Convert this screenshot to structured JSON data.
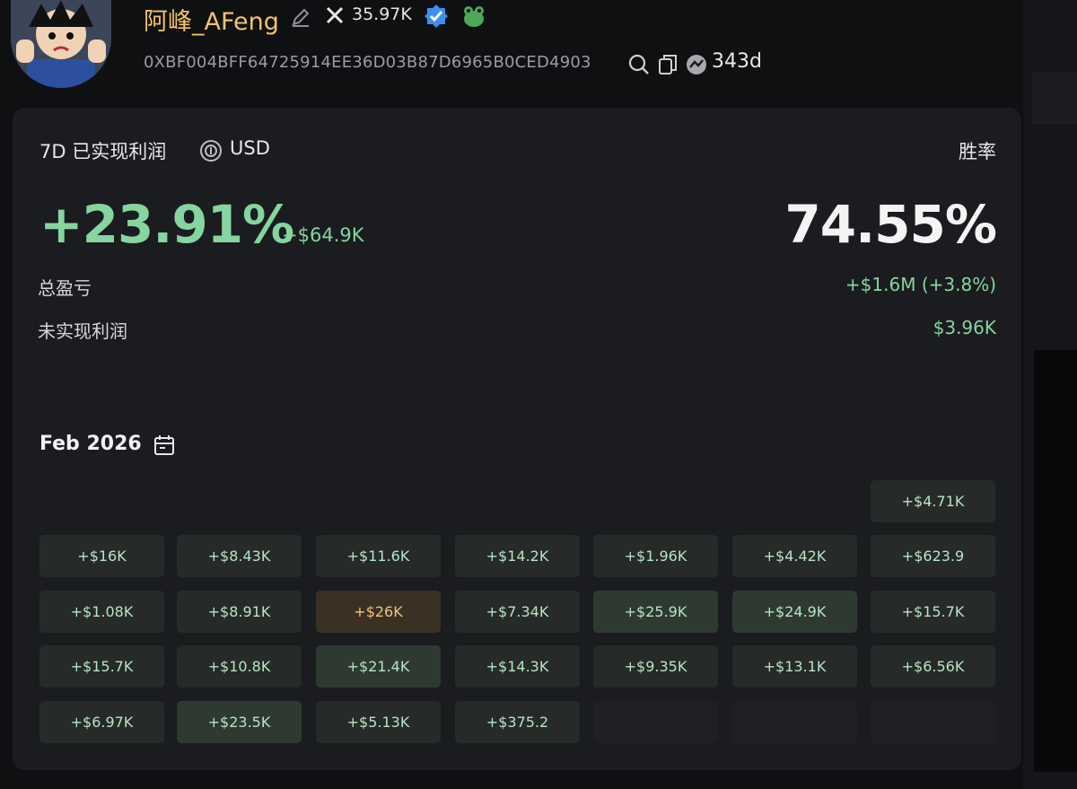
{
  "header": {
    "name": "阿峰_AFeng",
    "followers": "35.97K",
    "address": "0XBF004BFF64725914EE36D03B87D6965B0CED4903",
    "age": "343d",
    "icons": [
      "avatar",
      "edit-icon",
      "x-icon",
      "verified-icon",
      "frog-icon",
      "search-icon",
      "copy-icon",
      "age-icon"
    ]
  },
  "stats": {
    "period_label": "7D 已实现利润",
    "currency": "USD",
    "winrate_label": "胜率",
    "pnl_pct": "+23.91%",
    "pnl_abs": "+$64.9K",
    "winrate": "74.55%",
    "total_label": "总盈亏",
    "total_value": "+$1.6M (+3.8%)",
    "unrealized_label": "未实现利润",
    "unrealized_value": "$3.96K"
  },
  "calendar": {
    "month": "Feb 2026",
    "rows": [
      [
        "",
        "",
        "",
        "",
        "",
        "",
        "+$4.71K"
      ],
      [
        "+$16K",
        "+$8.43K",
        "+$11.6K",
        "+$14.2K",
        "+$1.96K",
        "+$4.42K",
        "+$623.9"
      ],
      [
        "+$1.08K",
        "+$8.91K",
        "+$26K",
        "+$7.34K",
        "+$25.9K",
        "+$24.9K",
        "+$15.7K"
      ],
      [
        "+$15.7K",
        "+$10.8K",
        "+$21.4K",
        "+$14.3K",
        "+$9.35K",
        "+$13.1K",
        "+$6.56K"
      ],
      [
        "+$6.97K",
        "+$23.5K",
        "+$5.13K",
        "+$375.2",
        "",
        "",
        ""
      ]
    ]
  },
  "colors": {
    "accent_green": "#86d49f",
    "name_gold": "#f3c26b",
    "top_day_gold": "#f0c27a"
  }
}
